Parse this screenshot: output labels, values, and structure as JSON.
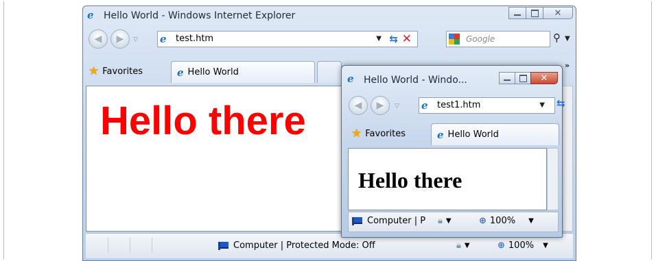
{
  "colors": {
    "accent": "#2c6fd1",
    "hello_red": "#ff0000",
    "stop_red": "#d2232a",
    "chrome": "#c9d9ee"
  },
  "main_window": {
    "title": "Hello World - Windows Internet Explorer",
    "address": "test.htm",
    "search_placeholder": "Google",
    "favorites_label": "Favorites",
    "tab_label": "Hello World",
    "page_heading": "Hello there",
    "status_text": "Computer | Protected Mode: Off",
    "zoom": "100%",
    "overflow_chevron": "»"
  },
  "popup_window": {
    "title": "Hello World - Windo...",
    "address": "test1.htm",
    "favorites_label": "Favorites",
    "tab_label": "Hello World",
    "page_heading": "Hello there",
    "status_text": "Computer | P",
    "zoom": "100%"
  },
  "icons": {
    "ie": "ie-logo-icon",
    "back": "back-arrow-icon",
    "forward": "forward-arrow-icon",
    "refresh": "refresh-icon",
    "stop": "stop-icon",
    "google": "google-icon",
    "search": "search-icon",
    "favorites": "star-icon",
    "zone": "computer-zone-icon",
    "zoom": "magnifier-icon"
  }
}
